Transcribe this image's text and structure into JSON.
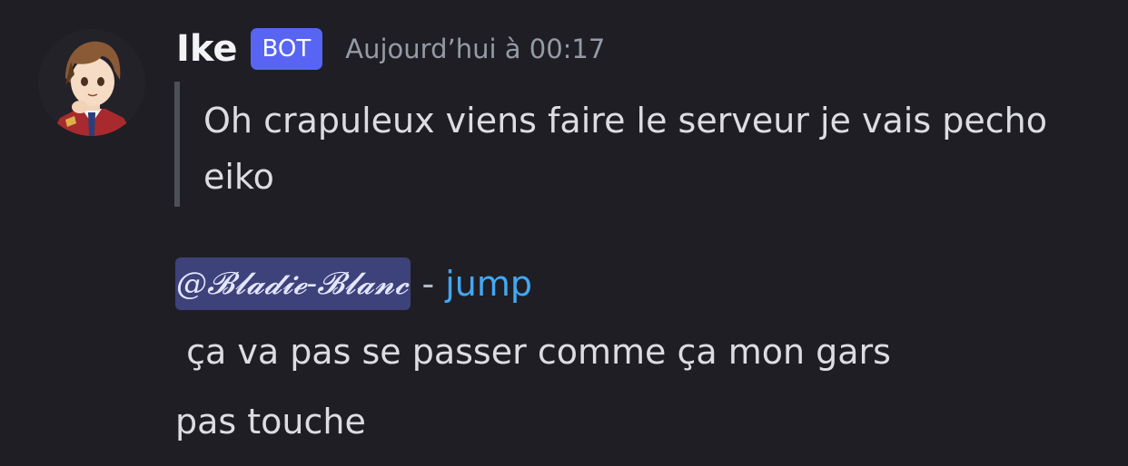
{
  "message": {
    "author": "Ike",
    "badge": "BOT",
    "timestamp": "Aujourd’hui à 00:17",
    "avatar_icon": "anime-boy-avatar",
    "quote_text": "Oh crapuleux viens faire le serveur je vais pecho eiko",
    "mention": "@𝓑𝓵𝓪𝓭𝓲𝓮-𝓑𝓵𝓪𝓷𝓬",
    "separator": "-",
    "jump_label": "jump",
    "lines": [
      " ça va pas se passer comme ça mon gars",
      "pas touche"
    ]
  },
  "colors": {
    "background": "#1f1e24",
    "badge": "#5865f2",
    "mention_bg": "#3d427a",
    "link": "#43a8f2",
    "quote_bar": "#4e5058"
  }
}
